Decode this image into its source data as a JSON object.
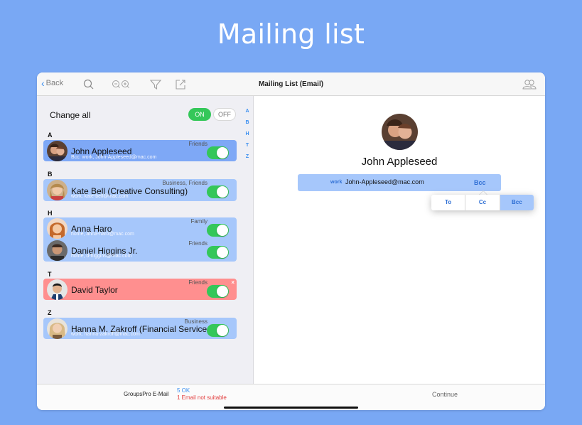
{
  "hero": {
    "title": "Mailing list"
  },
  "navbar": {
    "back_label": "Back",
    "title": "Mailing List (Email)",
    "icons": [
      "search-icon",
      "zoom-icon",
      "filter-icon",
      "share-icon",
      "contacts-icon"
    ]
  },
  "left": {
    "change_all_label": "Change all",
    "on_label": "ON",
    "off_label": "OFF",
    "index_letters": [
      "A",
      "B",
      "H",
      "T",
      "Z"
    ],
    "sections": [
      {
        "letter": "A"
      },
      {
        "letter": "B"
      },
      {
        "letter": "H"
      },
      {
        "letter": "T"
      },
      {
        "letter": "Z"
      }
    ],
    "rows": [
      {
        "name": "John Appleseed",
        "email": "Bcc: work, John-Appleseed@mac.com",
        "group": "Friends",
        "state": "selected",
        "enabled": true
      },
      {
        "name": "Kate Bell (Creative Consulting)",
        "email": "work, kate-bell@mac.com",
        "group": "Business, Friends",
        "state": "normal",
        "enabled": true
      },
      {
        "name": "Anna Haro",
        "email": "home, anna-haro@mac.com",
        "group": "Family",
        "state": "normal",
        "enabled": true
      },
      {
        "name": "Daniel Higgins Jr.",
        "email": "home, d-higgins@mac.com",
        "group": "Friends",
        "state": "normal",
        "enabled": true
      },
      {
        "name": "David Taylor",
        "email": "",
        "group": "Friends",
        "state": "error",
        "enabled": true,
        "close_glyph": "×"
      },
      {
        "name": "Hanna M. Zakroff (Financial Services)",
        "email": "work, hanna-zakroff@mac.com",
        "group": "Business",
        "state": "normal",
        "enabled": true
      }
    ]
  },
  "detail": {
    "name": "John Appleseed",
    "email_type": "work",
    "email": "John-Appleseed@mac.com",
    "email_kind": "Bcc",
    "options": [
      "To",
      "Cc",
      "Bcc"
    ],
    "active_option": "Bcc"
  },
  "bottom": {
    "app_name": "GroupsPro E-Mail",
    "ok_status": "5 OK",
    "error_status": "1 Email not suitable",
    "continue_label": "Continue"
  },
  "colors": {
    "background": "#79a8f4",
    "row_blue": "#a6c7fb",
    "row_selected": "#7ea8f6",
    "row_error": "#ff8f8f",
    "toggle_green": "#34c759",
    "accent": "#3a8ef0",
    "error_text": "#e23b3b"
  }
}
